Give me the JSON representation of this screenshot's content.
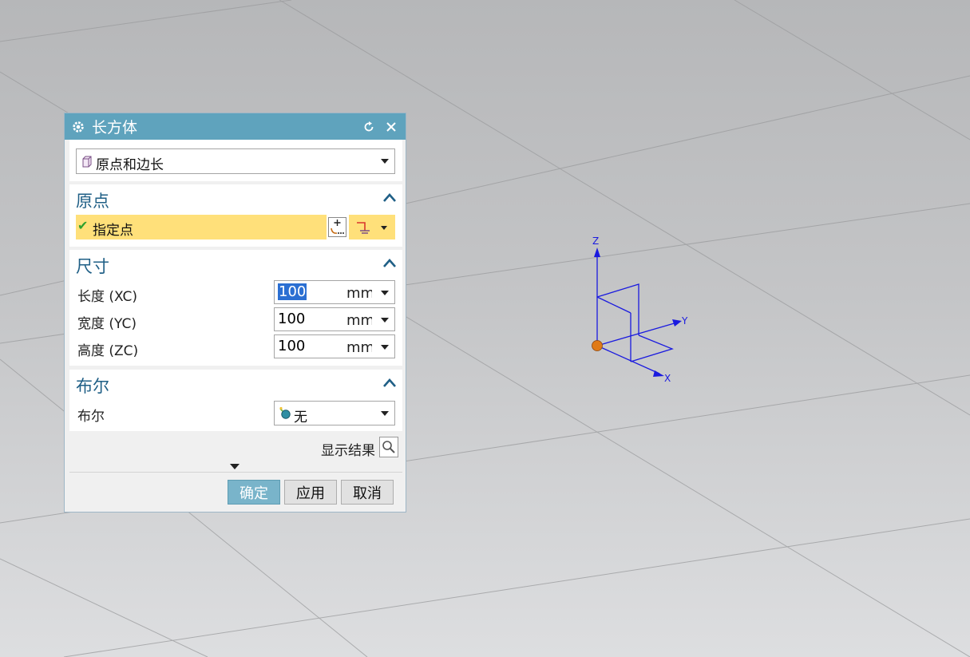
{
  "dialog": {
    "title": "长方体",
    "type_select": {
      "value": "原点和边长"
    },
    "origin": {
      "section_title": "原点",
      "specify_point_label": "指定点"
    },
    "dimensions": {
      "section_title": "尺寸",
      "rows": [
        {
          "label": "长度 (XC)",
          "value": "100",
          "unit": "mm"
        },
        {
          "label": "宽度 (YC)",
          "value": "100",
          "unit": "mm"
        },
        {
          "label": "高度 (ZC)",
          "value": "100",
          "unit": "mm"
        }
      ]
    },
    "boolean": {
      "section_title": "布尔",
      "label": "布尔",
      "value": "无"
    },
    "show_result_label": "显示结果",
    "buttons": {
      "ok": "确定",
      "apply": "应用",
      "cancel": "取消"
    }
  },
  "triad": {
    "x": "X",
    "y": "Y",
    "z": "Z"
  },
  "colors": {
    "title_bar": "#5fa3bd",
    "section_title": "#1f5f86",
    "highlight_row": "#ffe07a",
    "ok_button": "#79b4ca",
    "triad": "#1a1adf",
    "origin_point": "#e07a16"
  }
}
